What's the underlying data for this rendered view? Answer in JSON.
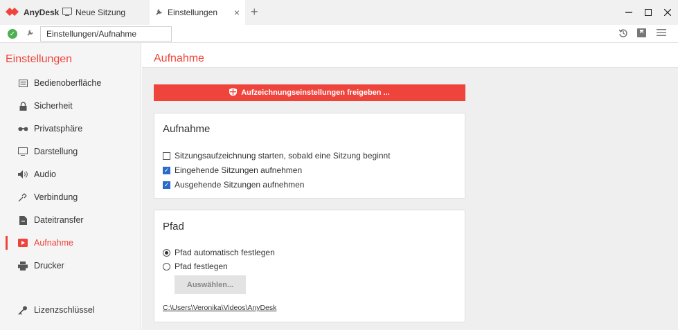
{
  "tabs": {
    "brand": "AnyDesk",
    "new_session": "Neue Sitzung",
    "settings": "Einstellungen"
  },
  "address": {
    "value": "Einstellungen/Aufnahme"
  },
  "sidebar": {
    "title": "Einstellungen",
    "items": [
      {
        "label": "Bedienoberfläche",
        "icon": "interface-icon"
      },
      {
        "label": "Sicherheit",
        "icon": "lock-icon"
      },
      {
        "label": "Privatsphäre",
        "icon": "glasses-icon"
      },
      {
        "label": "Darstellung",
        "icon": "monitor-icon"
      },
      {
        "label": "Audio",
        "icon": "speaker-icon"
      },
      {
        "label": "Verbindung",
        "icon": "connection-icon"
      },
      {
        "label": "Dateitransfer",
        "icon": "file-icon"
      },
      {
        "label": "Aufnahme",
        "icon": "record-icon",
        "active": true
      },
      {
        "label": "Drucker",
        "icon": "printer-icon"
      },
      {
        "label": "Lizenzschlüssel",
        "icon": "key-icon"
      }
    ]
  },
  "main": {
    "title": "Aufnahme",
    "unlock_button": "Aufzeichnungseinstellungen freigeben ...",
    "recording_card": {
      "title": "Aufnahme",
      "options": [
        {
          "label": "Sitzungsaufzeichnung starten, sobald eine Sitzung beginnt",
          "checked": false
        },
        {
          "label": "Eingehende Sitzungen aufnehmen",
          "checked": true
        },
        {
          "label": "Ausgehende Sitzungen aufnehmen",
          "checked": true
        }
      ]
    },
    "path_card": {
      "title": "Pfad",
      "radio_auto": "Pfad automatisch festlegen",
      "radio_manual": "Pfad festlegen",
      "choose_button": "Auswählen...",
      "path": "C:\\Users\\Veronika\\Videos\\AnyDesk"
    }
  },
  "colors": {
    "accent": "#ef443b",
    "checkbox": "#2a6ac9"
  }
}
